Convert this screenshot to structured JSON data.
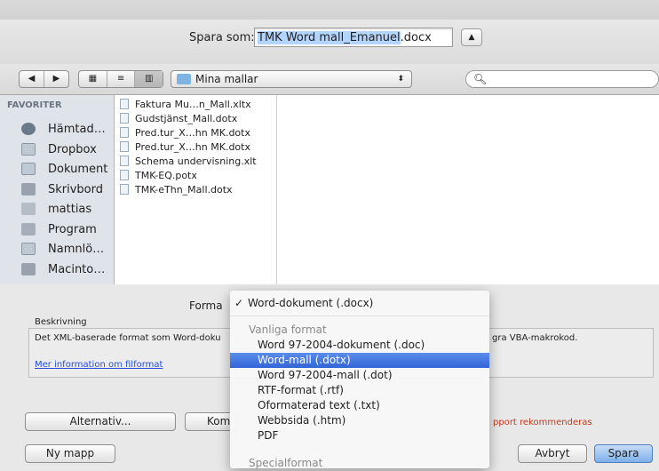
{
  "header": {
    "save_as_label": "Spara som:",
    "filename_selected": "TMK Word mall_Emanuel",
    "filename_ext": ".docx"
  },
  "toolbar": {
    "location": "Mina mallar",
    "search_placeholder": ""
  },
  "sidebar": {
    "header": "FAVORITER",
    "items": [
      {
        "label": "Hämtad…",
        "icon": "downloads-icon"
      },
      {
        "label": "Dropbox",
        "icon": "folder-icon"
      },
      {
        "label": "Dokument",
        "icon": "documents-icon"
      },
      {
        "label": "Skrivbord",
        "icon": "desktop-icon"
      },
      {
        "label": "mattias",
        "icon": "home-icon"
      },
      {
        "label": "Program",
        "icon": "applications-icon"
      },
      {
        "label": "Namnlö…",
        "icon": "folder-icon"
      },
      {
        "label": "Macinto…",
        "icon": "harddrive-icon"
      }
    ]
  },
  "files": [
    "Faktura Mu…n_Mall.xltx",
    "Gudstjänst_Mall.dotx",
    "Pred.tur_X…hn MK.dotx",
    "Pred.tur_X…hn MK.dotx",
    "Schema undervisning.xlt",
    "TMK-EQ.potx",
    "TMK-eThn_Mall.dotx"
  ],
  "bottom": {
    "format_label": "Forma",
    "description_title": "Beskrivning",
    "description_text": "Det XML-baserade format som Word-doku",
    "description_text_tail": "gra VBA-makrokod.",
    "more_info_link": "Mer information om filformat",
    "alternatives_button": "Alternativ...",
    "compat_button": "Kom",
    "warning_text": "pport rekommenderas",
    "new_folder_button": "Ny mapp",
    "cancel_button": "Avbryt",
    "save_button": "Spara"
  },
  "format_menu": {
    "checked_item": "Word-dokument (.docx)",
    "check_mark": "✓",
    "section_common": "Vanliga format",
    "items": [
      "Word 97-2004-dokument (.doc)",
      "Word-mall (.dotx)",
      "Word 97-2004-mall (.dot)",
      "RTF-format (.rtf)",
      "Oformaterad text (.txt)",
      "Webbsida (.htm)",
      "PDF"
    ],
    "selected_index": 1,
    "section_special": "Specialformat"
  },
  "colors": {
    "selection": "#3265d6",
    "link": "#2a4fd6",
    "warning": "#c2391e",
    "save_button": "#7fb0ea"
  }
}
